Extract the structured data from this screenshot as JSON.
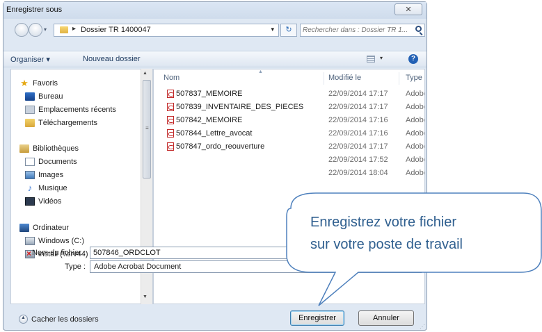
{
  "window": {
    "title": "Enregistrer sous",
    "close_glyph": "✕"
  },
  "address": {
    "path_separator": "▸",
    "folder": "Dossier TR 1400047",
    "dropdown_glyph": "▾",
    "refresh_glyph": "↻",
    "search_placeholder": "Rechercher dans : Dossier TR 1..."
  },
  "toolbar": {
    "organize": "Organiser ▾",
    "new_folder": "Nouveau dossier",
    "view_dropdown": "▾",
    "help": "?"
  },
  "nav": {
    "favorites": "Favoris",
    "desktop": "Bureau",
    "recent": "Emplacements récents",
    "downloads": "Téléchargements",
    "libraries": "Bibliothèques",
    "documents": "Documents",
    "images": "Images",
    "music": "Musique",
    "videos": "Vidéos",
    "computer": "Ordinateur",
    "drive_c": "Windows (C:)",
    "drive_i": "install (\\\\srv44) (I:)"
  },
  "icons": {
    "favorites": "star-icon",
    "desktop": "desktop-icon",
    "recent": "recent-places-icon",
    "downloads": "downloads-folder-icon",
    "libraries": "library-icon",
    "documents": "document-icon",
    "images": "picture-icon",
    "music": "music-note-icon",
    "videos": "video-icon",
    "computer": "computer-icon",
    "drive_c": "drive-icon",
    "drive_i": "network-drive-disconnected-icon",
    "file": "pdf-file-icon"
  },
  "columns": {
    "name": "Nom",
    "modified": "Modifié le",
    "type": "Type"
  },
  "files": [
    {
      "name": "507837_MEMOIRE",
      "date": "22/09/2014 17:17",
      "type": "Adobe"
    },
    {
      "name": "507839_INVENTAIRE_DES_PIECES",
      "date": "22/09/2014 17:17",
      "type": "Adobe"
    },
    {
      "name": "507842_MEMOIRE",
      "date": "22/09/2014 17:16",
      "type": "Adobe"
    },
    {
      "name": "507844_Lettre_avocat",
      "date": "22/09/2014 17:16",
      "type": "Adobe"
    },
    {
      "name": "507847_ordo_reouverture",
      "date": "22/09/2014 17:17",
      "type": "Adobe"
    },
    {
      "name": "",
      "date": "22/09/2014 17:52",
      "type": "Adobe"
    },
    {
      "name": "",
      "date": "22/09/2014 18:04",
      "type": "Adobe"
    }
  ],
  "form": {
    "filename_label": "Nom du fichier :",
    "filename_value": "507846_ORDCLOT",
    "type_label": "Type :",
    "type_value": "Adobe Acrobat Document"
  },
  "footer": {
    "hide_folders": "Cacher les dossiers",
    "save": "Enregistrer",
    "cancel": "Annuler"
  },
  "callout": {
    "line1": "Enregistrez  votre  fichier",
    "line2": "sur votre poste de travail"
  },
  "colors": {
    "callout_fill": "#ffffff",
    "callout_border": "#4f81bd",
    "callout_text": "#2f5f8f"
  }
}
